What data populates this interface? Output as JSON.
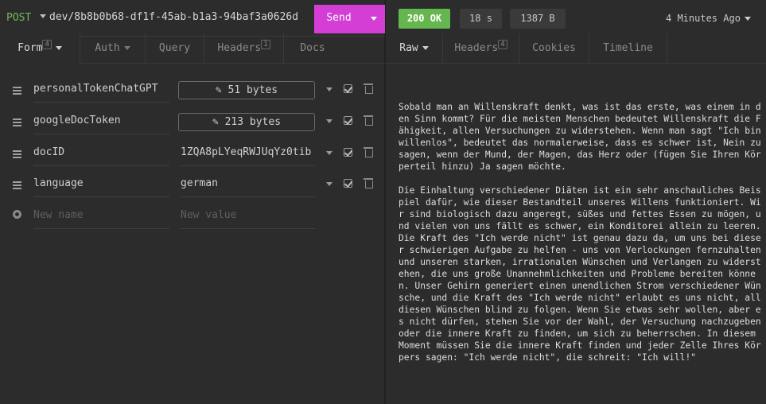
{
  "request": {
    "method": "POST",
    "url": "dev/8b8b0b68-df1f-45ab-b1a3-94baf3a0626d",
    "send_label": "Send"
  },
  "left_tabs": {
    "form": "Form",
    "form_count": "4",
    "auth": "Auth",
    "query": "Query",
    "headers": "Headers",
    "headers_count": "1",
    "docs": "Docs"
  },
  "form_fields": [
    {
      "name": "personalTokenChatGPT",
      "value": "51 bytes",
      "type": "file"
    },
    {
      "name": "googleDocToken",
      "value": "213 bytes",
      "type": "file"
    },
    {
      "name": "docID",
      "value": "1ZQA8pLYeqRWJUqYz0tib",
      "type": "text"
    },
    {
      "name": "language",
      "value": "german",
      "type": "text"
    }
  ],
  "new_field": {
    "name_placeholder": "New name",
    "value_placeholder": "New value"
  },
  "response": {
    "status": "200 OK",
    "status_color": "#66b64f",
    "time": "18 s",
    "size": "1387 B",
    "ago": "4 Minutes Ago"
  },
  "right_tabs": {
    "raw": "Raw",
    "headers": "Headers",
    "headers_count": "4",
    "cookies": "Cookies",
    "timeline": "Timeline"
  },
  "body": {
    "p1": "Sobald man an Willenskraft denkt, was ist das erste, was einem in den Sinn kommt? Für die meisten Menschen bedeutet Willenskraft die Fähigkeit, allen Versuchungen zu widerstehen. Wenn man sagt \"Ich bin willenlos\", bedeutet das normalerweise, dass es schwer ist, Nein zu sagen, wenn der Mund, der Magen, das Herz oder (fügen Sie Ihren Körperteil hinzu) Ja sagen möchte.",
    "p2": "Die Einhaltung verschiedener Diäten ist ein sehr anschauliches Beispiel dafür, wie dieser Bestandteil unseres Willens funktioniert. Wir sind biologisch dazu angeregt, süßes und fettes Essen zu mögen, und vielen von uns fällt es schwer, ein Konditorei allein zu leeren. Die Kraft des \"Ich werde nicht\" ist genau dazu da, um uns bei dieser schwierigen Aufgabe zu helfen - uns von Verlockungen fernzuhalten und unseren starken, irrationalen Wünschen und Verlangen zu widerstehen, die uns große Unannehmlichkeiten und Probleme bereiten können. Unser Gehirn generiert einen unendlichen Strom verschiedener Wünsche, und die Kraft des \"Ich werde nicht\" erlaubt es uns nicht, all diesen Wünschen blind zu folgen. Wenn Sie etwas sehr wollen, aber es nicht dürfen, stehen Sie vor der Wahl, der Versuchung nachzugeben oder die innere Kraft zu finden, um sich zu beherrschen. In diesem Moment müssen Sie die innere Kraft finden und jeder Zelle Ihres Körpers sagen: \"Ich werde nicht\", die schreit: \"Ich will!\""
  },
  "colors": {
    "send_button": "#d43ed4",
    "method": "#73b85b",
    "background": "#2c2c2c"
  }
}
